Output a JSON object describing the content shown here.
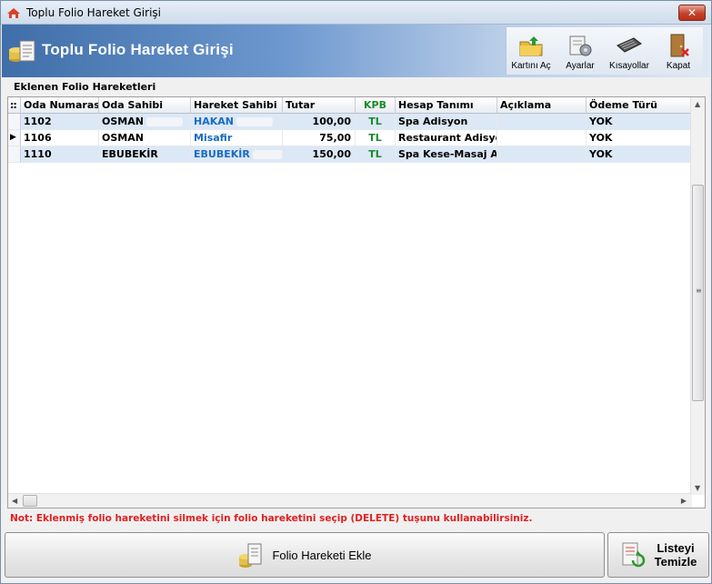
{
  "window": {
    "title": "Toplu Folio Hareket Girişi",
    "close_label": "✕"
  },
  "header": {
    "title": "Toplu Folio Hareket Girişi"
  },
  "toolbar": {
    "items": [
      {
        "label": "Kartını Aç",
        "icon": "open-card-icon"
      },
      {
        "label": "Ayarlar",
        "icon": "settings-icon"
      },
      {
        "label": "Kısayollar",
        "icon": "keyboard-icon"
      },
      {
        "label": "Kapat",
        "icon": "exit-door-icon"
      }
    ]
  },
  "grid": {
    "section_label": "Eklenen Folio Hareketleri",
    "indicator_header": "::",
    "columns": [
      "Oda Numarası",
      "Oda Sahibi",
      "Hareket Sahibi",
      "Tutar",
      "KPB",
      "Hesap Tanımı",
      "Açıklama",
      "Ödeme Türü"
    ],
    "rows": [
      {
        "oda_no": "1102",
        "oda_sahibi": "OSMAN",
        "hareket_sahibi": "HAKAN",
        "tutar": "100,00",
        "kpb": "TL",
        "hesap": "Spa Adisyon",
        "aciklama": "",
        "odeme": "YOK",
        "current": false
      },
      {
        "oda_no": "1106",
        "oda_sahibi": "OSMAN",
        "hareket_sahibi": "Misafir",
        "tutar": "75,00",
        "kpb": "TL",
        "hesap": "Restaurant Adisyon",
        "aciklama": "",
        "odeme": "YOK",
        "current": true
      },
      {
        "oda_no": "1110",
        "oda_sahibi": "EBUBEKİR",
        "hareket_sahibi": "EBUBEKİR",
        "tutar": "150,00",
        "kpb": "TL",
        "hesap": "Spa Kese-Masaj Ad",
        "aciklama": "",
        "odeme": "YOK",
        "current": false
      }
    ],
    "current_row_marker": "▶"
  },
  "note": "Not: Eklenmiş folio hareketini silmek için folio hareketini seçip (DELETE) tuşunu kullanabilirsiniz.",
  "buttons": {
    "add_label": "Folio Hareketi Ekle",
    "clear_line1": "Listeyi",
    "clear_line2": "Temizle"
  },
  "colors": {
    "note": "#e02020",
    "blue_text": "#1a6bc2",
    "green_text": "#1a8a2a",
    "row_alt": "#dce8f6",
    "header_gradient_start": "#3f6ea8"
  }
}
